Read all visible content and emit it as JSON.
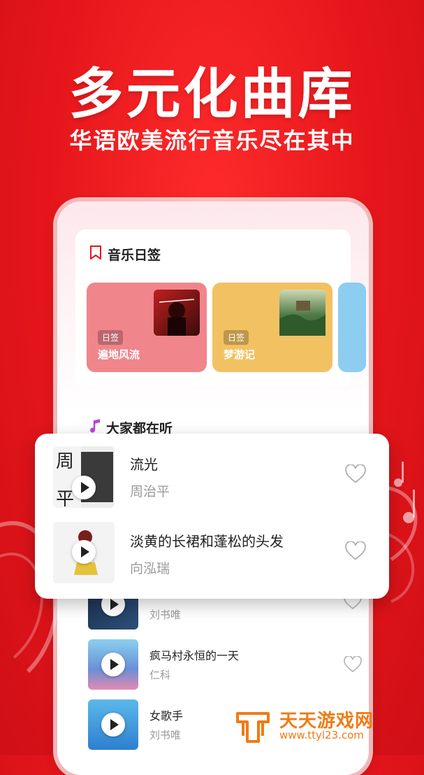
{
  "promo": {
    "headline": "多元化曲库",
    "subline": "华语欧美流行音乐尽在其中"
  },
  "daily_card": {
    "title": "音乐日签",
    "tiles": [
      {
        "tag": "日签",
        "name": "遍地风流",
        "color": "#f0858c"
      },
      {
        "tag": "日签",
        "name": "梦游记",
        "color": "#f2c262"
      }
    ]
  },
  "popular": {
    "title": "大家都在听"
  },
  "popup_songs": [
    {
      "title": "流光",
      "artist": "周治平"
    },
    {
      "title": "淡黄的长裙和蓬松的头发",
      "artist": "向泓瑞"
    }
  ],
  "list_songs": [
    {
      "title": "",
      "artist": "刘书唯"
    },
    {
      "title": "疯马村永恒的一天",
      "artist": "仁科"
    },
    {
      "title": "女歌手",
      "artist": "刘书唯"
    }
  ],
  "watermark": {
    "title": "天天游戏网",
    "url": "www.ttyl23.com"
  },
  "colors": {
    "background": "#e5161b",
    "accent": "#e5161b",
    "watermark": "#f07b14"
  }
}
